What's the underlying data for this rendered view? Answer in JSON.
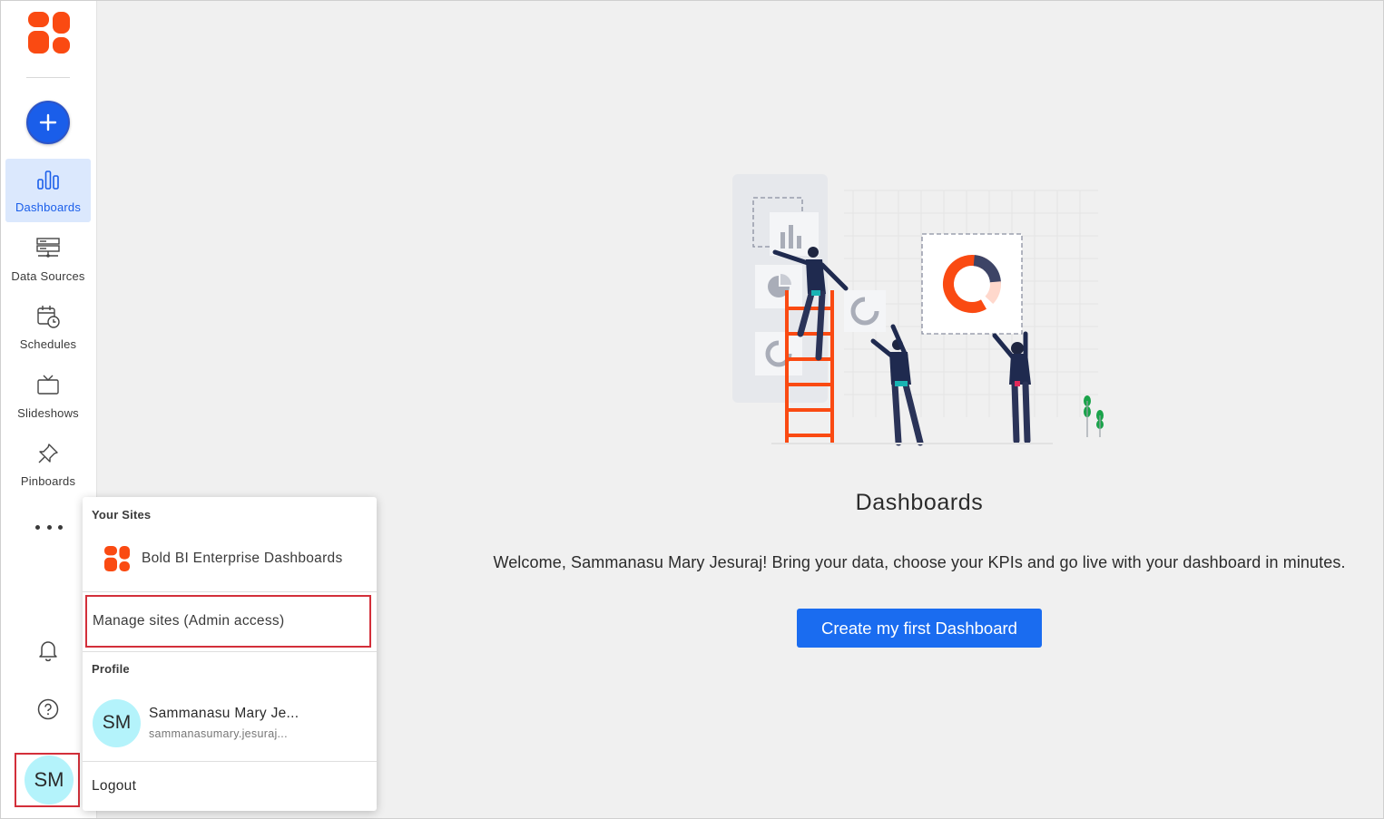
{
  "sidebar": {
    "nav": [
      {
        "label": "Dashboards",
        "icon": "bar-chart-icon",
        "active": true
      },
      {
        "label": "Data Sources",
        "icon": "server-stack-icon",
        "active": false
      },
      {
        "label": "Schedules",
        "icon": "calendar-clock-icon",
        "active": false
      },
      {
        "label": "Slideshows",
        "icon": "tv-icon",
        "active": false
      },
      {
        "label": "Pinboards",
        "icon": "pin-icon",
        "active": false
      }
    ],
    "avatar_initials": "SM"
  },
  "menu": {
    "your_sites_heading": "Your Sites",
    "site_name": "Bold BI Enterprise Dashboards",
    "manage_sites_label": "Manage sites (Admin access)",
    "profile_heading": "Profile",
    "profile_initials": "SM",
    "profile_name": "Sammanasu Mary Je...",
    "profile_email": "sammanasumary.jesuraj...",
    "logout_label": "Logout"
  },
  "main": {
    "title": "Dashboards",
    "welcome": "Welcome, Sammanasu Mary Jesuraj! Bring your data, choose your KPIs and go live with your dashboard in minutes.",
    "cta_label": "Create my first Dashboard"
  },
  "colors": {
    "brand_orange": "#fa4a12",
    "primary_blue": "#1a6cf0",
    "highlight_red": "#d32f3a",
    "avatar_bg": "#b4f3fb"
  }
}
